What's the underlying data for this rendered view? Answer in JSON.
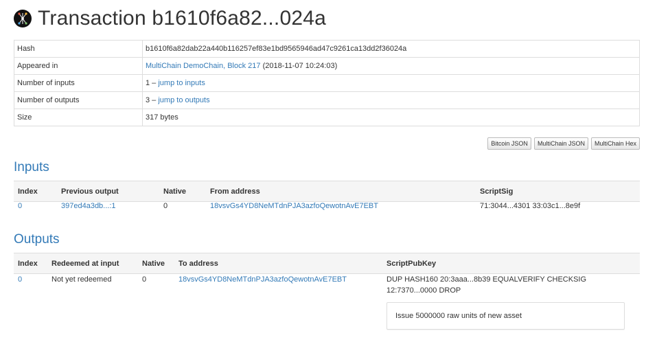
{
  "header": {
    "title": "Transaction b1610f6a82...024a"
  },
  "summary": {
    "hash_label": "Hash",
    "hash_value": "b1610f6a82dab22a440b116257ef83e1bd9565946ad47c9261ca13dd2f36024a",
    "appeared_label": "Appeared in",
    "appeared_link": "MultiChain DemoChain, Block 217",
    "appeared_time": "(2018-11-07 10:24:03)",
    "inputs_label": "Number of inputs",
    "inputs_count": "1 –",
    "inputs_link": "jump to inputs",
    "outputs_label": "Number of outputs",
    "outputs_count": "3 –",
    "outputs_link": "jump to outputs",
    "size_label": "Size",
    "size_value": "317 bytes"
  },
  "buttons": {
    "bitcoin_json": "Bitcoin JSON",
    "multichain_json": "MultiChain JSON",
    "multichain_hex": "MultiChain Hex"
  },
  "inputs": {
    "heading": "Inputs",
    "columns": [
      "Index",
      "Previous output",
      "Native",
      "From address",
      "ScriptSig"
    ],
    "rows": [
      {
        "index": "0",
        "previous_output": "397ed4a3db...:1",
        "native": "0",
        "from_address": "18vsvGs4YD8NeMTdnPJA3azfoQewotnAvE7EBT",
        "scriptsig": "71:3044...4301 33:03c1...8e9f"
      }
    ]
  },
  "outputs": {
    "heading": "Outputs",
    "columns": [
      "Index",
      "Redeemed at input",
      "Native",
      "To address",
      "ScriptPubKey"
    ],
    "rows": [
      {
        "index": "0",
        "redeemed": "Not yet redeemed",
        "native": "0",
        "to_address": "18vsvGs4YD8NeMTdnPJA3azfoQewotnAvE7EBT",
        "scriptpubkey_line1": "DUP HASH160 20:3aaa...8b39 EQUALVERIFY CHECKSIG",
        "scriptpubkey_line2": "12:7370...0000 DROP",
        "note": "Issue 5000000 raw units of new asset"
      }
    ]
  }
}
